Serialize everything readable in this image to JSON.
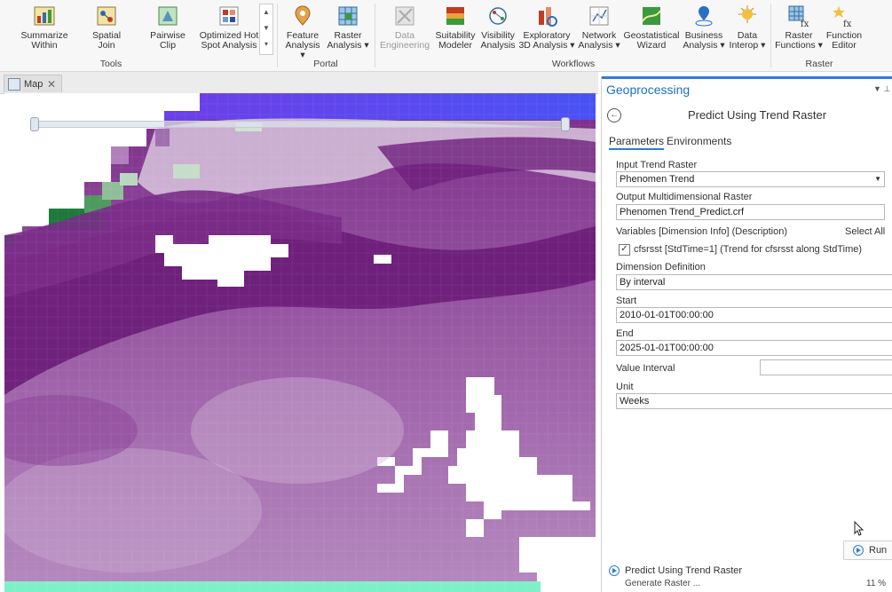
{
  "ribbon": {
    "tools": {
      "group_label": "Tools",
      "buttons": [
        {
          "line1": "Summarize",
          "line2": "Within",
          "icon": "summarize-within-icon"
        },
        {
          "line1": "Spatial",
          "line2": "Join",
          "icon": "spatial-join-icon"
        },
        {
          "line1": "Pairwise",
          "line2": "Clip",
          "icon": "pairwise-clip-icon"
        },
        {
          "line1": "Optimized Hot",
          "line2": "Spot Analysis",
          "icon": "hot-spot-icon"
        }
      ]
    },
    "portal": {
      "group_label": "Portal",
      "buttons": [
        {
          "line1": "Feature",
          "line2": "Analysis ▾",
          "icon": "feature-analysis-icon"
        },
        {
          "line1": "Raster",
          "line2": "Analysis ▾",
          "icon": "raster-analysis-icon"
        }
      ]
    },
    "workflows": {
      "group_label": "Workflows",
      "buttons": [
        {
          "line1": "Data",
          "line2": "Engineering",
          "icon": "data-engineering-icon"
        },
        {
          "line1": "Suitability",
          "line2": "Modeler",
          "icon": "suitability-modeler-icon"
        },
        {
          "line1": "Visibility",
          "line2": "Analysis",
          "icon": "visibility-analysis-icon"
        },
        {
          "line1": "Exploratory",
          "line2": "3D Analysis ▾",
          "icon": "exploratory-3d-icon"
        },
        {
          "line1": "Network",
          "line2": "Analysis ▾",
          "icon": "network-analysis-icon"
        },
        {
          "line1": "Geostatistical",
          "line2": "Wizard",
          "icon": "geostatistical-wizard-icon"
        },
        {
          "line1": "Business",
          "line2": "Analysis ▾",
          "icon": "business-analysis-icon"
        },
        {
          "line1": "Data",
          "line2": "Interop ▾",
          "icon": "data-interop-icon"
        }
      ]
    },
    "raster": {
      "group_label": "Raster",
      "buttons": [
        {
          "line1": "Raster",
          "line2": "Functions ▾",
          "icon": "raster-functions-icon"
        },
        {
          "line1": "Function",
          "line2": "Editor",
          "icon": "function-editor-icon"
        }
      ]
    }
  },
  "map": {
    "tab_label": "Map",
    "close_glyph": "✕"
  },
  "gp": {
    "pane_title": "Geoprocessing",
    "tool_title": "Predict Using Trend Raster",
    "tabs": {
      "parameters": "Parameters",
      "environments": "Environments"
    },
    "input_trend_label": "Input Trend Raster",
    "input_trend_value": "Phenomen Trend",
    "output_label": "Output Multidimensional Raster",
    "output_value": "Phenomen Trend_Predict.crf",
    "variables_label": "Variables [Dimension Info] (Description)",
    "select_all": "Select All",
    "variable_item": "cfsrsst [StdTime=1] (Trend for cfsrsst along StdTime)",
    "variable_checked": true,
    "dimension_def_label": "Dimension Definition",
    "dimension_def_value": "By interval",
    "start_label": "Start",
    "start_value": "2010-01-01T00:00:00",
    "end_label": "End",
    "end_value": "2025-01-01T00:00:00",
    "value_interval_label": "Value Interval",
    "value_interval_value": "",
    "unit_label": "Unit",
    "unit_value": "Weeks",
    "run_label": "Run",
    "status_title": "Predict Using Trend Raster",
    "status_sub": "Generate Raster ...",
    "status_pct": "11 %"
  },
  "colors": {
    "accent": "#2d7dd2",
    "map_purple": "#6e1f7c",
    "map_blue": "#5a3cf0",
    "map_green": "#1c7a3a",
    "map_mint": "#7ef0c8"
  }
}
